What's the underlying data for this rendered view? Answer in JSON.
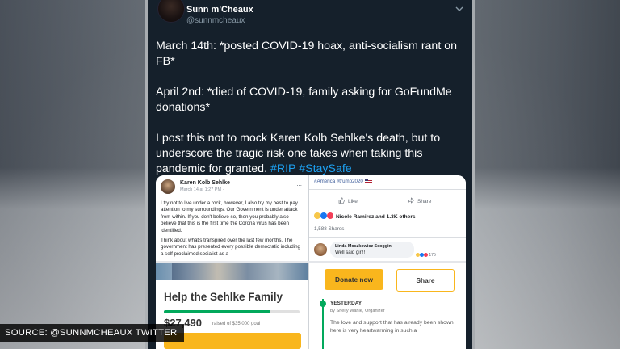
{
  "tweet": {
    "user_name": "Sunn m'Cheaux",
    "user_handle": "@sunnmcheaux",
    "paragraphs": [
      "March 14th: *posted COVID-19 hoax, anti-socialism rant on FB*",
      "April 2nd: *died of COVID-19, family asking for GoFundMe donations*",
      "I post this not to mock Karen Kolb Sehlke's death, but to underscore the tragic risk one takes when taking this pandemic for granted."
    ],
    "hashtags": [
      "#RIP",
      "#StaySafe"
    ]
  },
  "fb_post": {
    "author": "Karen Kolb Sehlke",
    "date": "March 14 at 1:27 PM · ",
    "more": "...",
    "body": [
      "I try not to live under a rock, however, I also try my best to pay attention to my surroundings. Our Government is under attack from within. If you don't believe so, then you probably also believe that this is the first time the Corona virus has been identified.",
      "Think about what's transpired over the last few months. The government has presented every possible democratic including a self proclaimed socialist as a"
    ]
  },
  "fb_reactions": {
    "hashtags": "#America #trump2020",
    "like_label": "Like",
    "share_label": "Share",
    "reactions_text": "Nicole Ramirez and 1.3K others",
    "shares_text": "1,588 Shares",
    "comment_author": "Linda Moszkowicz Scoggin",
    "comment_text": "Well said girl!!",
    "comment_reactions": "175"
  },
  "gofundme": {
    "title": "Help the Sehlke Family",
    "raised": "$27,490",
    "goal_text": "raised of $35,000 goal",
    "progress_fraction": 0.785,
    "donate_label": "Donate now",
    "share_label": "Share",
    "update_when": "YESTERDAY",
    "update_by": "by Shelly Wahle, Organizer",
    "update_text": "The love and support that has already been shown here is very heartwarming in such a"
  },
  "caption": "SOURCE: @SUNNMCHEAUX TWITTER",
  "colors": {
    "tweet_bg": "#15202b",
    "twitter_blue": "#1da1f2",
    "gfm_green": "#02a95c",
    "gfm_yellow": "#f9b61d"
  }
}
